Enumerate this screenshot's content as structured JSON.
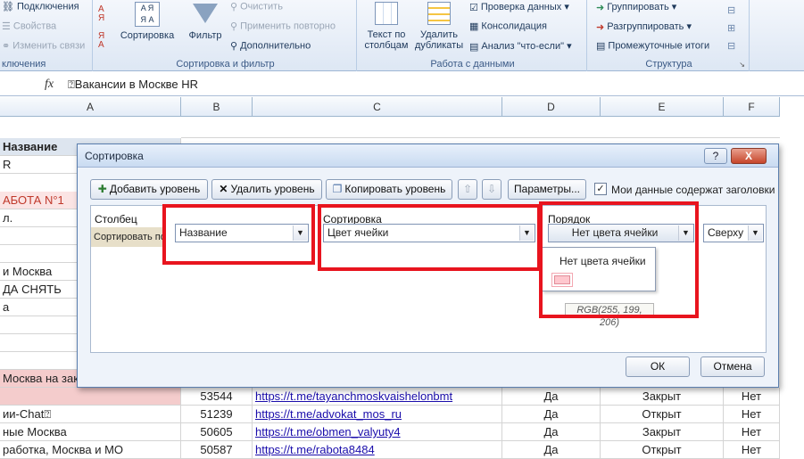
{
  "ribbon": {
    "connections": {
      "items": [
        "Подключения",
        "Свойства",
        "Изменить связи"
      ],
      "group_label": "ключения"
    },
    "sortfilter": {
      "sort_az": "А Я",
      "sort_za": "Я А",
      "sort_label": "Сортировка",
      "filter_label": "Фильтр",
      "clear_label": "Очистить",
      "reapply_label": "Применить повторно",
      "advanced_label": "Дополнительно",
      "group_label": "Сортировка и фильтр"
    },
    "datatools": {
      "text_to_columns": [
        "Текст по",
        "столбцам"
      ],
      "remove_dups": [
        "Удалить",
        "дубликаты"
      ],
      "validation": "Проверка данных",
      "consolidate": "Консолидация",
      "whatif": "Анализ \"что-если\"",
      "group_label": "Работа с данными"
    },
    "outline": {
      "group": "Группировать",
      "ungroup": "Разгруппировать",
      "subtotal": "Промежуточные итоги",
      "group_label": "Структура"
    }
  },
  "formula_bar": {
    "fx": "fx",
    "content": "⍰Вакансии в Москве HR"
  },
  "columns": [
    "A",
    "B",
    "C",
    "D",
    "E",
    "F"
  ],
  "sheet": {
    "header_a": "Название",
    "visible_left": [
      {
        "text": "R"
      },
      {
        "text": "АБОТА N°1",
        "red": true
      },
      {
        "text": "л."
      },
      {
        "text": ""
      },
      {
        "text": ""
      },
      {
        "text": "и Москва"
      },
      {
        "text": "ДА СНЯТЬ"
      },
      {
        "text": "а"
      },
      {
        "text": ""
      },
      {
        "text": ""
      },
      {
        "text": ""
      },
      {
        "text": "Москва на зак",
        "pink": true
      }
    ],
    "rows": [
      {
        "a": "",
        "b": "53544",
        "c": "https://t.me/tayanchmoskvaishelonbmt",
        "d": "Да",
        "e": "Закрыт",
        "f": "Нет"
      },
      {
        "a": "ии-Chat⍰",
        "b": "51239",
        "c": "https://t.me/advokat_mos_ru",
        "d": "Да",
        "e": "Открыт",
        "f": "Нет"
      },
      {
        "a": "ные Москва",
        "b": "50605",
        "c": "https://t.me/obmen_valyuty4",
        "d": "Да",
        "e": "Закрыт",
        "f": "Нет"
      },
      {
        "a": "работка, Москва и МО",
        "b": "50587",
        "c": "https://t.me/rabota8484",
        "d": "Да",
        "e": "Открыт",
        "f": "Нет"
      }
    ]
  },
  "dialog": {
    "title": "Сортировка",
    "help": "?",
    "close": "X",
    "add_level": "Добавить уровень",
    "delete_level": "Удалить уровень",
    "copy_level": "Копировать уровень",
    "options": "Параметры...",
    "headers_checkbox": "Мои данные содержат заголовки",
    "col_header": "Столбец",
    "sort_header": "Сортировка",
    "order_header": "Порядок",
    "sort_by": "Сортировать по",
    "column_value": "Название",
    "sort_on_value": "Цвет ячейки",
    "order_value": "Нет цвета ячейки",
    "position_value": "Сверху",
    "dropdown_option": "Нет цвета ячейки",
    "tooltip": "RGB(255, 199, 206)",
    "ok": "ОК",
    "cancel": "Отмена"
  },
  "colors": {
    "highlight": "#e8141e",
    "swatch": "#ffc7ce",
    "link": "#1a0dab"
  }
}
